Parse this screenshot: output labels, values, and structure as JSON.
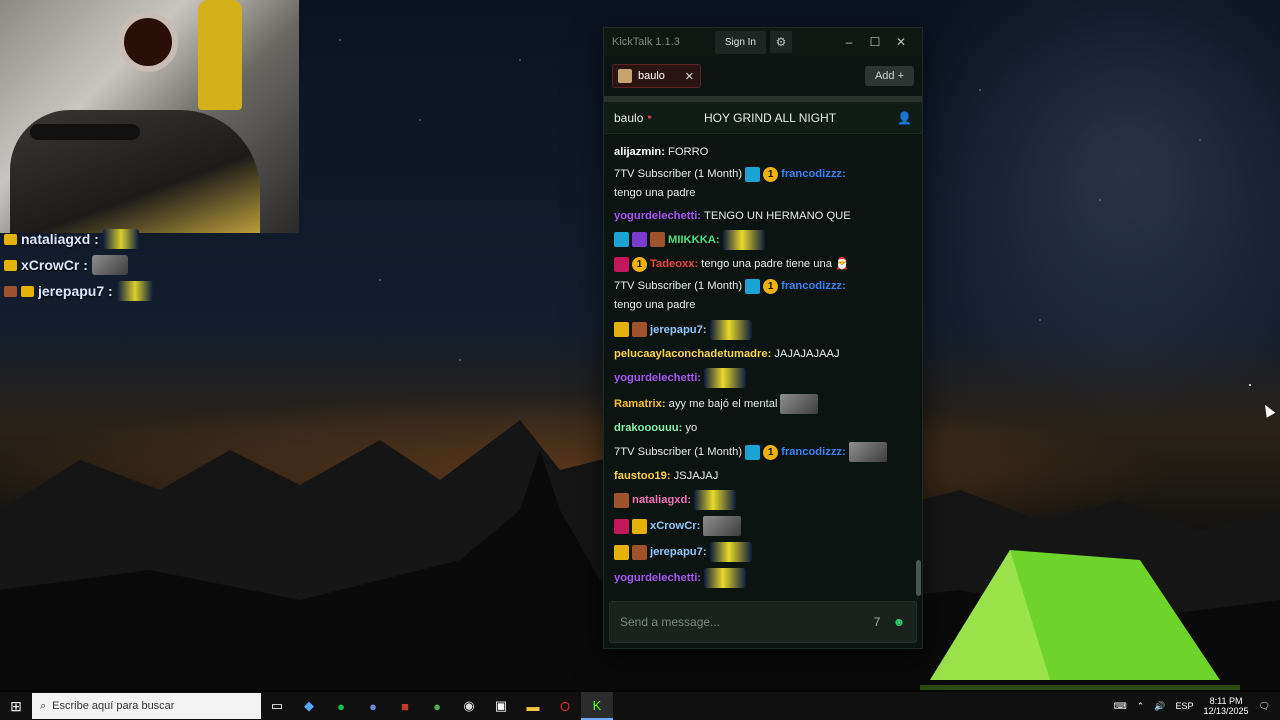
{
  "overlay_chat": [
    {
      "name": "nataliagxd :",
      "badges": [
        "crown"
      ]
    },
    {
      "name": "xCrowCr :",
      "badges": [
        "crown"
      ]
    },
    {
      "name": "jerepapu7 :",
      "badges": [
        "hammer",
        "crown"
      ]
    }
  ],
  "kicktalk": {
    "title": "KickTalk 1.1.3",
    "signin_label": "Sign In",
    "tab": {
      "label": "baulo"
    },
    "add_label": "Add +",
    "streamer": "baulo",
    "stream_title": "HOY GRIND ALL NIGHT",
    "input_placeholder": "Send a message...",
    "messages": [
      {
        "name": "alijazmin:",
        "text": "FORRO",
        "color": "#ffffff"
      },
      {
        "prefix": "7TV Subscriber (1 Month)",
        "name": "francodizzz:",
        "text": "tengo una padre",
        "color": "#3b82f6"
      },
      {
        "name": "yogurdelechetti:",
        "text": "TENGO UN HERMANO QUE",
        "color": "#a855f7"
      },
      {
        "name": "MIIKKKA:",
        "text": "",
        "color": "#4ade80"
      },
      {
        "name": "Tadeoxx:",
        "text": "tengo una padre tiene una",
        "color": "#ef4444"
      },
      {
        "prefix": "7TV Subscriber (1 Month)",
        "name": "francodizzz:",
        "text": "tengo una padre",
        "color": "#3b82f6"
      },
      {
        "name": "jerepapu7:",
        "text": "",
        "color": "#93c5fd"
      },
      {
        "name": "pelucaaylaconchadetumadre:",
        "text": "JAJAJAJAAJ",
        "color": "#fcd34d"
      },
      {
        "name": "yogurdelechetti:",
        "text": "",
        "color": "#a855f7"
      },
      {
        "name": "Ramatrix:",
        "text": "ayy me bajó el mental",
        "color": "#fbbf24"
      },
      {
        "name": "drakooouuu:",
        "text": "yo",
        "color": "#86efac"
      },
      {
        "prefix": "7TV Subscriber (1 Month)",
        "name": "francodizzz:",
        "text": "",
        "color": "#3b82f6"
      },
      {
        "name": "faustoo19:",
        "text": "JSJAJAJ",
        "color": "#fcd34d"
      },
      {
        "name": "nataliagxd:",
        "text": "",
        "color": "#f472b6"
      },
      {
        "name": "xCrowCr:",
        "text": "",
        "color": "#93c5fd"
      },
      {
        "name": "jerepapu7:",
        "text": "",
        "color": "#93c5fd"
      },
      {
        "name": "yogurdelechetti:",
        "text": "",
        "color": "#a855f7"
      }
    ]
  },
  "taskbar": {
    "search_placeholder": "Escribe aquí para buscar",
    "lang": "ESP",
    "time": "8:11 PM",
    "date": "12/13/2025"
  }
}
